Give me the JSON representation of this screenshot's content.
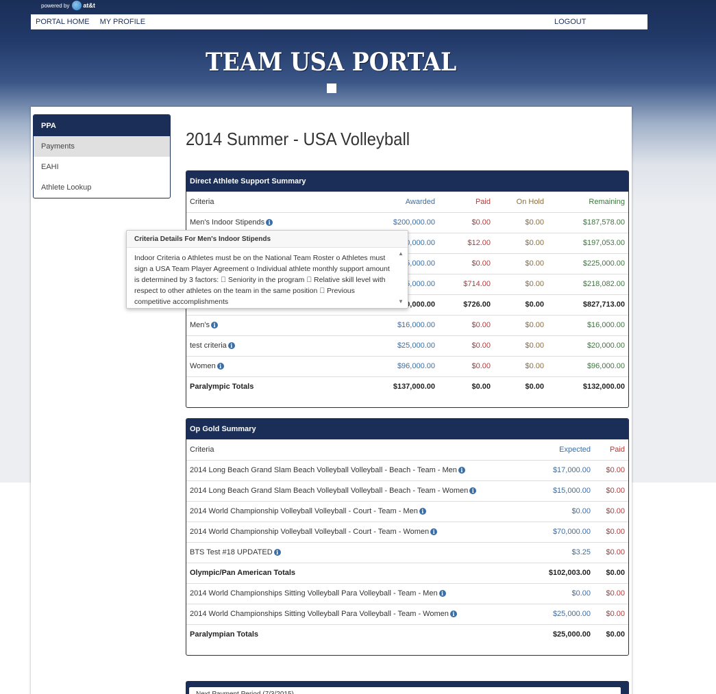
{
  "brand": {
    "powered_by": "powered by",
    "att": "at&t",
    "logo": "TEAM USA PORTAL"
  },
  "nav": {
    "home": "PORTAL HOME",
    "profile": "MY PROFILE",
    "logout": "LOGOUT"
  },
  "sidebar": {
    "title": "PPA",
    "items": [
      {
        "label": "Payments",
        "active": true
      },
      {
        "label": "EAHI",
        "active": false
      },
      {
        "label": "Athlete Lookup",
        "active": false
      }
    ]
  },
  "page_title": "2014 Summer - USA Volleyball",
  "das": {
    "title": "Direct Athlete Support Summary",
    "headers": {
      "criteria": "Criteria",
      "awarded": "Awarded",
      "paid": "Paid",
      "on_hold": "On Hold",
      "remaining": "Remaining"
    },
    "rows": [
      {
        "criteria": "Men's Indoor Stipends",
        "awarded": "$200,000.00",
        "paid": "$0.00",
        "on_hold": "$0.00",
        "remaining": "$187,578.00"
      },
      {
        "criteria": "",
        "awarded": "$200,000.00",
        "paid": "$12.00",
        "on_hold": "$0.00",
        "remaining": "$197,053.00"
      },
      {
        "criteria": "",
        "awarded": "$225,000.00",
        "paid": "$0.00",
        "on_hold": "$0.00",
        "remaining": "$225,000.00"
      },
      {
        "criteria": "",
        "awarded": "$225,000.00",
        "paid": "$714.00",
        "on_hold": "$0.00",
        "remaining": "$218,082.00"
      },
      {
        "criteria": "",
        "awarded": "$850,000.00",
        "paid": "$726.00",
        "on_hold": "$0.00",
        "remaining": "$827,713.00",
        "total": true
      },
      {
        "criteria": "Men's",
        "awarded": "$16,000.00",
        "paid": "$0.00",
        "on_hold": "$0.00",
        "remaining": "$16,000.00"
      },
      {
        "criteria": "test criteria",
        "awarded": "$25,000.00",
        "paid": "$0.00",
        "on_hold": "$0.00",
        "remaining": "$20,000.00"
      },
      {
        "criteria": "Women",
        "awarded": "$96,000.00",
        "paid": "$0.00",
        "on_hold": "$0.00",
        "remaining": "$96,000.00"
      },
      {
        "criteria": "Paralympic Totals",
        "awarded": "$137,000.00",
        "paid": "$0.00",
        "on_hold": "$0.00",
        "remaining": "$132,000.00",
        "total": true
      }
    ]
  },
  "popover": {
    "title": "Criteria Details For Men's Indoor Stipends",
    "body": "Indoor Criteria o Athletes must be on the National Team Roster o Athletes must sign a USA Team Player Agreement o Individual athlete monthly support amount is determined by 3 factors:  Seniority in the program  Relative skill level with respect to other athletes on the team in the same position  Previous competitive accomplishments"
  },
  "opgold": {
    "title": "Op Gold Summary",
    "headers": {
      "criteria": "Criteria",
      "expected": "Expected",
      "paid": "Paid"
    },
    "rows": [
      {
        "criteria": "2014 Long Beach Grand Slam Beach Volleyball Volleyball - Beach - Team - Men",
        "expected": "$17,000.00",
        "paid": "$0.00"
      },
      {
        "criteria": "2014 Long Beach Grand Slam Beach Volleyball Volleyball - Beach - Team - Women",
        "expected": "$15,000.00",
        "paid": "$0.00"
      },
      {
        "criteria": "2014 World Championship Volleyball Volleyball - Court - Team - Men",
        "expected": "$0.00",
        "paid": "$0.00"
      },
      {
        "criteria": "2014 World Championship Volleyball Volleyball - Court - Team - Women",
        "expected": "$70,000.00",
        "paid": "$0.00"
      },
      {
        "criteria": "BTS Test #18 UPDATED",
        "expected": "$3.25",
        "paid": "$0.00"
      },
      {
        "criteria": "Olympic/Pan American Totals",
        "expected": "$102,003.00",
        "paid": "$0.00",
        "total": true
      },
      {
        "criteria": "2014 World Championships Sitting Volleyball Para Volleyball - Team - Men",
        "expected": "$0.00",
        "paid": "$0.00"
      },
      {
        "criteria": "2014 World Championships Sitting Volleyball Para Volleyball - Team - Women",
        "expected": "$25,000.00",
        "paid": "$0.00"
      },
      {
        "criteria": "Paralympian Totals",
        "expected": "$25,000.00",
        "paid": "$0.00",
        "total": true
      }
    ]
  },
  "next_payment": {
    "label": "Next Payment Period (7/3/2015)"
  },
  "colors": {
    "navy": "#1a2e57",
    "awarded": "#3a6ea5",
    "paid": "#b03a3a",
    "on_hold": "#8a6d3b",
    "remaining": "#3c763d"
  }
}
